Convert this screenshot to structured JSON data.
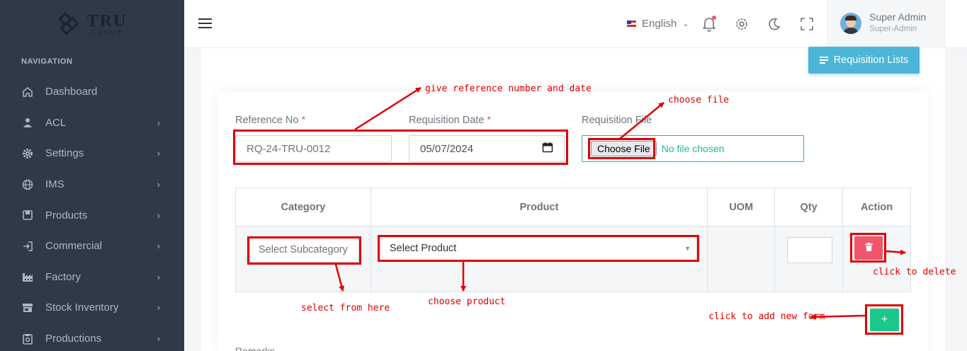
{
  "sidebar": {
    "logo_big": "TRU",
    "logo_small": "GROUP",
    "nav_heading": "NAVIGATION",
    "items": [
      {
        "label": "Dashboard",
        "icon": "home-icon",
        "has_children": false
      },
      {
        "label": "ACL",
        "icon": "user-icon",
        "has_children": true
      },
      {
        "label": "Settings",
        "icon": "cog-icon",
        "has_children": true
      },
      {
        "label": "IMS",
        "icon": "globe-icon",
        "has_children": true
      },
      {
        "label": "Products",
        "icon": "box-icon",
        "has_children": true
      },
      {
        "label": "Commercial",
        "icon": "sign-in-icon",
        "has_children": true
      },
      {
        "label": "Factory",
        "icon": "factory-icon",
        "has_children": true
      },
      {
        "label": "Stock Inventory",
        "icon": "store-icon",
        "has_children": true
      },
      {
        "label": "Productions",
        "icon": "clipboard-icon",
        "has_children": true
      }
    ]
  },
  "topbar": {
    "language": "English",
    "user_name": "Super Admin",
    "user_role": "Super-Admin"
  },
  "page": {
    "requisition_lists_button": "Requisition Lists",
    "reference_label": "Reference No",
    "reference_value": "RQ-24-TRU-0012",
    "date_label": "Requisition Date",
    "date_value": "05/07/2024",
    "required_mark": "*",
    "file_label": "Requisition File",
    "choose_file": "Choose File",
    "no_file": "No file chosen",
    "table_headers": [
      "Category",
      "Product",
      "UOM",
      "Qty",
      "Action"
    ],
    "subcategory_placeholder": "Select Subcategory",
    "product_placeholder": "Select Product",
    "add_label": "+",
    "remarks_label": "Remarks"
  },
  "annotations": {
    "reference_date": "give reference number and date",
    "choose_file": "choose file",
    "delete": "click to delete",
    "select_from_here": "select from here",
    "choose_product": "choose product",
    "add_form": "click to add new form"
  },
  "colors": {
    "sidebar_bg": "#2f3a48",
    "accent_info": "#4db6d8",
    "danger": "#f1556c",
    "success": "#1bc88a",
    "annotation_red": "#e00000",
    "file_border": "#1abc9c"
  }
}
